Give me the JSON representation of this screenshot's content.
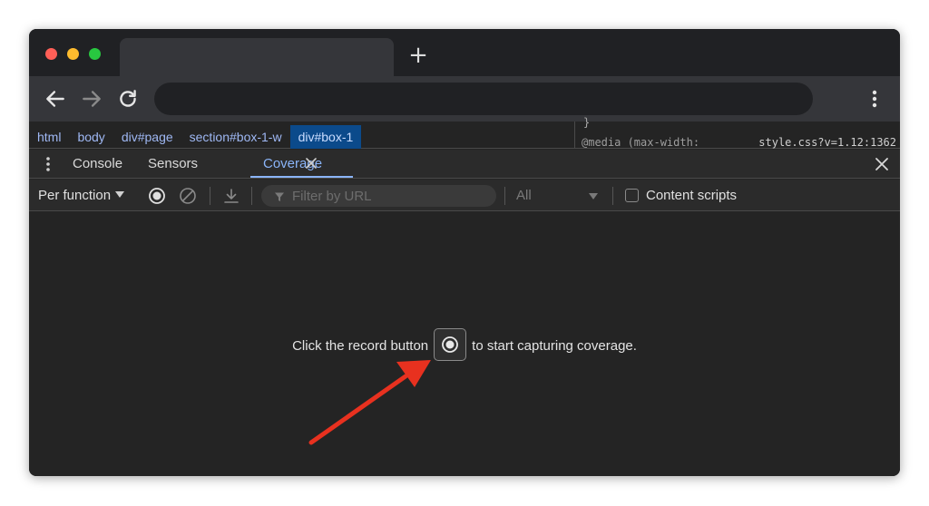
{
  "breadcrumbs": [
    {
      "label": "html"
    },
    {
      "label": "body"
    },
    {
      "label": "div#page"
    },
    {
      "label": "section#box-1-w"
    },
    {
      "label": "div#box-1",
      "selected": true
    }
  ],
  "styles_pane": {
    "brace": "}",
    "media_text": "@media (max-width:",
    "source_link": "style.css?v=1.12:1362"
  },
  "drawer_tabs": {
    "console": "Console",
    "sensors": "Sensors",
    "coverage": "Coverage"
  },
  "coverage_toolbar": {
    "mode_label": "Per function",
    "filter_placeholder": "Filter by URL",
    "type_select": "All",
    "content_scripts_label": "Content scripts"
  },
  "empty_state": {
    "before": "Click the record button",
    "after": "to start capturing coverage."
  },
  "colors": {
    "accent": "#8ab4f8",
    "selected_crumb": "#0b4a8b",
    "annotation_arrow": "#e8311f",
    "traffic_red": "#ff5f57",
    "traffic_yellow": "#febc2e",
    "traffic_green": "#28c840"
  },
  "icons": {
    "back": "arrow-left-icon",
    "forward": "arrow-right-icon",
    "reload": "reload-icon",
    "menu": "kebab-icon",
    "record": "record-icon",
    "clear": "clear-icon",
    "export": "download-icon",
    "filter": "filter-icon",
    "close": "close-icon"
  }
}
